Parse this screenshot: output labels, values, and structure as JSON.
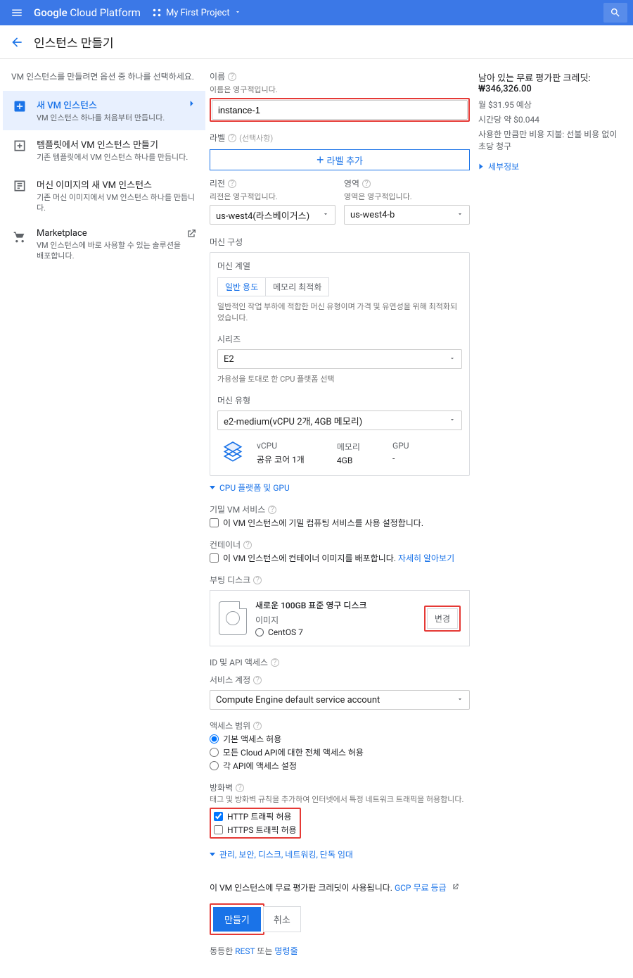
{
  "topbar": {
    "brand_a": "Google",
    "brand_b": "Cloud Platform",
    "project": "My First Project"
  },
  "subheader": {
    "title": "인스턴스 만들기"
  },
  "sidebar": {
    "intro": "VM 인스턴스를 만들려면 옵션 중 하나를 선택하세요.",
    "items": [
      {
        "title": "새 VM 인스턴스",
        "sub": "VM 인스턴스 하나를 처음부터 만듭니다."
      },
      {
        "title": "템플릿에서 VM 인스턴스 만들기",
        "sub": "기존 템플릿에서 VM 인스턴스 하나를 만듭니다."
      },
      {
        "title": "머신 이미지의 새 VM 인스턴스",
        "sub": "기존 머신 이미지에서 VM 인스턴스 하나를 만듭니다."
      },
      {
        "title": "Marketplace",
        "sub": "VM 인스턴스에 바로 사용할 수 있는 솔루션을 배포합니다."
      }
    ]
  },
  "form": {
    "name_label": "이름",
    "name_hint": "이름은 영구적입니다.",
    "name_value": "instance-1",
    "labels_label": "라벨",
    "labels_optional": "(선택사항)",
    "add_label_btn": "라벨 추가",
    "region_label": "리전",
    "region_hint": "리전은 영구적입니다.",
    "region_value": "us-west4(라스베이거스)",
    "zone_label": "영역",
    "zone_hint": "영역은 영구적입니다.",
    "zone_value": "us-west4-b",
    "mc_title": "머신 구성",
    "mc_family": "머신 계열",
    "mc_tab_general": "일반 용도",
    "mc_tab_memory": "메모리 최적화",
    "mc_tab_desc": "일반적인 작업 부하에 적합한 머신 유형이며 가격 및 유연성을 위해 최적화되었습니다.",
    "series_label": "시리즈",
    "series_value": "E2",
    "series_hint": "가용성을 토대로 한 CPU 플랫폼 선택",
    "mtype_label": "머신 유형",
    "mtype_value": "e2-medium(vCPU 2개, 4GB 메모리)",
    "mc_cols": {
      "vcpu_h": "vCPU",
      "vcpu_v": "공유 코어 1개",
      "mem_h": "메모리",
      "mem_v": "4GB",
      "gpu_h": "GPU",
      "gpu_v": "-"
    },
    "cpu_gpu_link": "CPU 플랫폼 및 GPU",
    "conf_vm_label": "기밀 VM 서비스",
    "conf_vm_check": "이 VM 인스턴스에 기밀 컴퓨팅 서비스를 사용 설정합니다.",
    "container_label": "컨테이너",
    "container_check": "이 VM 인스턴스에 컨테이너 이미지를 배포합니다.",
    "container_more": "자세히 알아보기",
    "bootdisk_label": "부팅 디스크",
    "bootdisk_title": "새로운 100GB 표준 영구 디스크",
    "bootdisk_img": "이미지",
    "bootdisk_os": "CentOS 7",
    "bootdisk_change": "변경",
    "idapi_label": "ID 및 API 액세스",
    "svc_acct_label": "서비스 계정",
    "svc_acct_value": "Compute Engine default service account",
    "scope_label": "액세스 범위",
    "scope_r1": "기본 액세스 허용",
    "scope_r2": "모든 Cloud API에 대한 전체 액세스 허용",
    "scope_r3": "각 API에 액세스 설정",
    "fw_label": "방화벽",
    "fw_hint": "태그 및 방화벽 규칙을 추가하여 인터넷에서 특정 네트워크 트래픽을 허용합니다.",
    "fw_http": "HTTP 트래픽 허용",
    "fw_https": "HTTPS 트래픽 허용",
    "more_link": "관리, 보안, 디스크, 네트워킹, 단독 임대",
    "trial_note_a": "이 VM 인스턴스에 무료 평가판 크레딧이 사용됩니다.",
    "trial_note_link": "GCP 무료 등급",
    "create_btn": "만들기",
    "cancel_btn": "취소",
    "equiv": "동등한",
    "equiv_rest": "REST",
    "equiv_or": " 또는 ",
    "equiv_cmd": "명령줄"
  },
  "right": {
    "title_a": "남아 있는 무료 평가판 크레딧:",
    "title_amt": "₩346,326.00",
    "monthly": "월 $31.95 예상",
    "hourly": "시간당 약 $0.044",
    "note": "사용한 만큼만 비용 지불: 선불 비용 없이 초당 청구",
    "details": "세부정보"
  }
}
